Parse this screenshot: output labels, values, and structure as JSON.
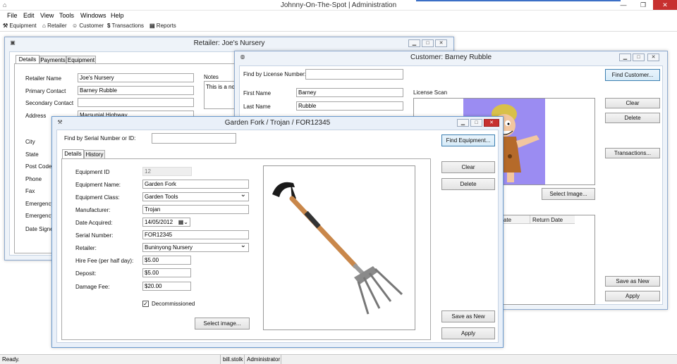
{
  "app": {
    "title": "Johnny-On-The-Spot | Administration",
    "min": "—",
    "max": "❐",
    "close": "✕"
  },
  "menu": [
    {
      "label": "File"
    },
    {
      "label": "Edit"
    },
    {
      "label": "View"
    },
    {
      "label": "Tools"
    },
    {
      "label": "Windows"
    },
    {
      "label": "Help"
    }
  ],
  "toolbar": [
    {
      "label": "Equipment",
      "icon": "wrench-icon"
    },
    {
      "label": "Retailer",
      "icon": "shop-icon"
    },
    {
      "label": "Customer",
      "icon": "user-icon"
    },
    {
      "label": "Transactions",
      "icon": "dollar-icon"
    },
    {
      "label": "Reports",
      "icon": "report-icon"
    }
  ],
  "status": {
    "text": "Ready.",
    "user": "bill.stolk",
    "role": "Administrator"
  },
  "retailer": {
    "title": "Retailer: Joe's Nursery",
    "tabs": [
      "Details",
      "Payments",
      "Equipment"
    ],
    "fields": {
      "name_label": "Retailer Name",
      "name": "Joe's Nursery",
      "contact_label": "Primary Contact",
      "contact": "Barney Rubble",
      "secondary_label": "Secondary Contact",
      "secondary": "",
      "address_label": "Address",
      "address": "Marsupial Highway",
      "city_label": "City",
      "state_label": "State",
      "postcode_label": "Post Code",
      "phone_label": "Phone",
      "fax_label": "Fax",
      "emergency1_label": "Emergency P",
      "emergency2_label": "Emergency P",
      "datesigned_label": "Date Signed",
      "notes_label": "Notes",
      "notes": "This is a not"
    }
  },
  "customer": {
    "title": "Customer: Barney Rubble",
    "find_label": "Find by License Number:",
    "find_value": "",
    "find_button": "Find Customer...",
    "first_label": "First Name",
    "first": "Barney",
    "last_label": "Last Name",
    "last": "Rubble",
    "scan_label": "License Scan",
    "clear": "Clear",
    "delete": "Delete",
    "transactions": "Transactions...",
    "select_image": "Select Image...",
    "grid_cols": [
      "ate",
      "Return Date"
    ],
    "save_new": "Save as New",
    "apply": "Apply"
  },
  "equipment": {
    "title": "Garden Fork / Trojan / FOR12345",
    "find_label": "Find by Serial Number or ID:",
    "find_value": "",
    "find_button": "Find Equipment...",
    "tabs": [
      "Details",
      "History"
    ],
    "id_label": "Equipment ID",
    "id": "12",
    "name_label": "Equipment Name:",
    "name": "Garden Fork",
    "class_label": "Equipment Class:",
    "class": "Garden Tools",
    "manufacturer_label": "Manufacturer:",
    "manufacturer": "Trojan",
    "date_label": "Date Acquired:",
    "date": "14/05/2012",
    "serial_label": "Serial Number:",
    "serial": "FOR12345",
    "retailer_label": "Retailer:",
    "retailer": "Buninyong Nursery",
    "hire_label": "Hire Fee (per half day):",
    "hire": "$5.00",
    "deposit_label": "Deposit:",
    "deposit": "$5.00",
    "damage_label": "Damage Fee:",
    "damage": "$20.00",
    "decom_label": "Decommissioned",
    "decom_checked": true,
    "select_image": "Select image...",
    "clear": "Clear",
    "delete": "Delete",
    "save_new": "Save as New",
    "apply": "Apply"
  }
}
